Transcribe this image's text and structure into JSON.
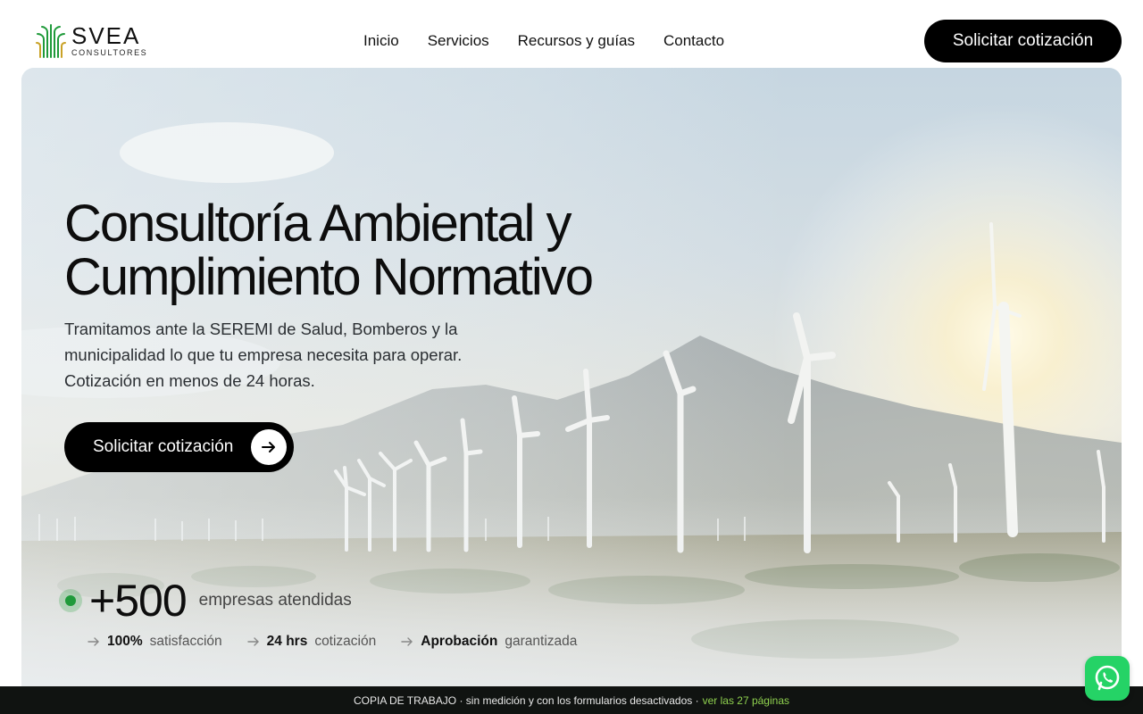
{
  "brand": {
    "name": "SVEA",
    "subtitle": "CONSULTORES",
    "accent": "#1f9a3a"
  },
  "nav": {
    "items": [
      {
        "label": "Inicio"
      },
      {
        "label": "Servicios"
      },
      {
        "label": "Recursos y guías"
      },
      {
        "label": "Contacto"
      }
    ],
    "cta_label": "Solicitar cotización"
  },
  "hero": {
    "title_line1": "Consultoría Ambiental y",
    "title_line2": "Cumplimiento Normativo",
    "lead_line1": "Tramitamos ante la SEREMI de Salud, Bomberos y la",
    "lead_line2": "municipalidad lo que tu empresa necesita para operar.",
    "lead_line3": "Cotización en menos de 24 horas.",
    "cta_label": "Solicitar cotización",
    "stat_value": "+500",
    "stat_label": "empresas atendidas",
    "features": [
      {
        "bold": "100%",
        "rest": "satisfacción"
      },
      {
        "bold": "24 hrs",
        "rest": "cotización"
      },
      {
        "bold": "Aprobación",
        "rest": "garantizada"
      }
    ]
  },
  "watermark": {
    "text": "COPIA DE TRABAJO · sin medición y con los formularios desactivados ·",
    "link": "ver las 27 páginas"
  },
  "icons": [
    "logo-mark-icon",
    "arrow-right-icon",
    "whatsapp-icon"
  ],
  "colors": {
    "button_bg": "#000000",
    "bar_bg": "#101311",
    "bar_link": "#8fd14f",
    "whatsapp": "#25d366"
  }
}
